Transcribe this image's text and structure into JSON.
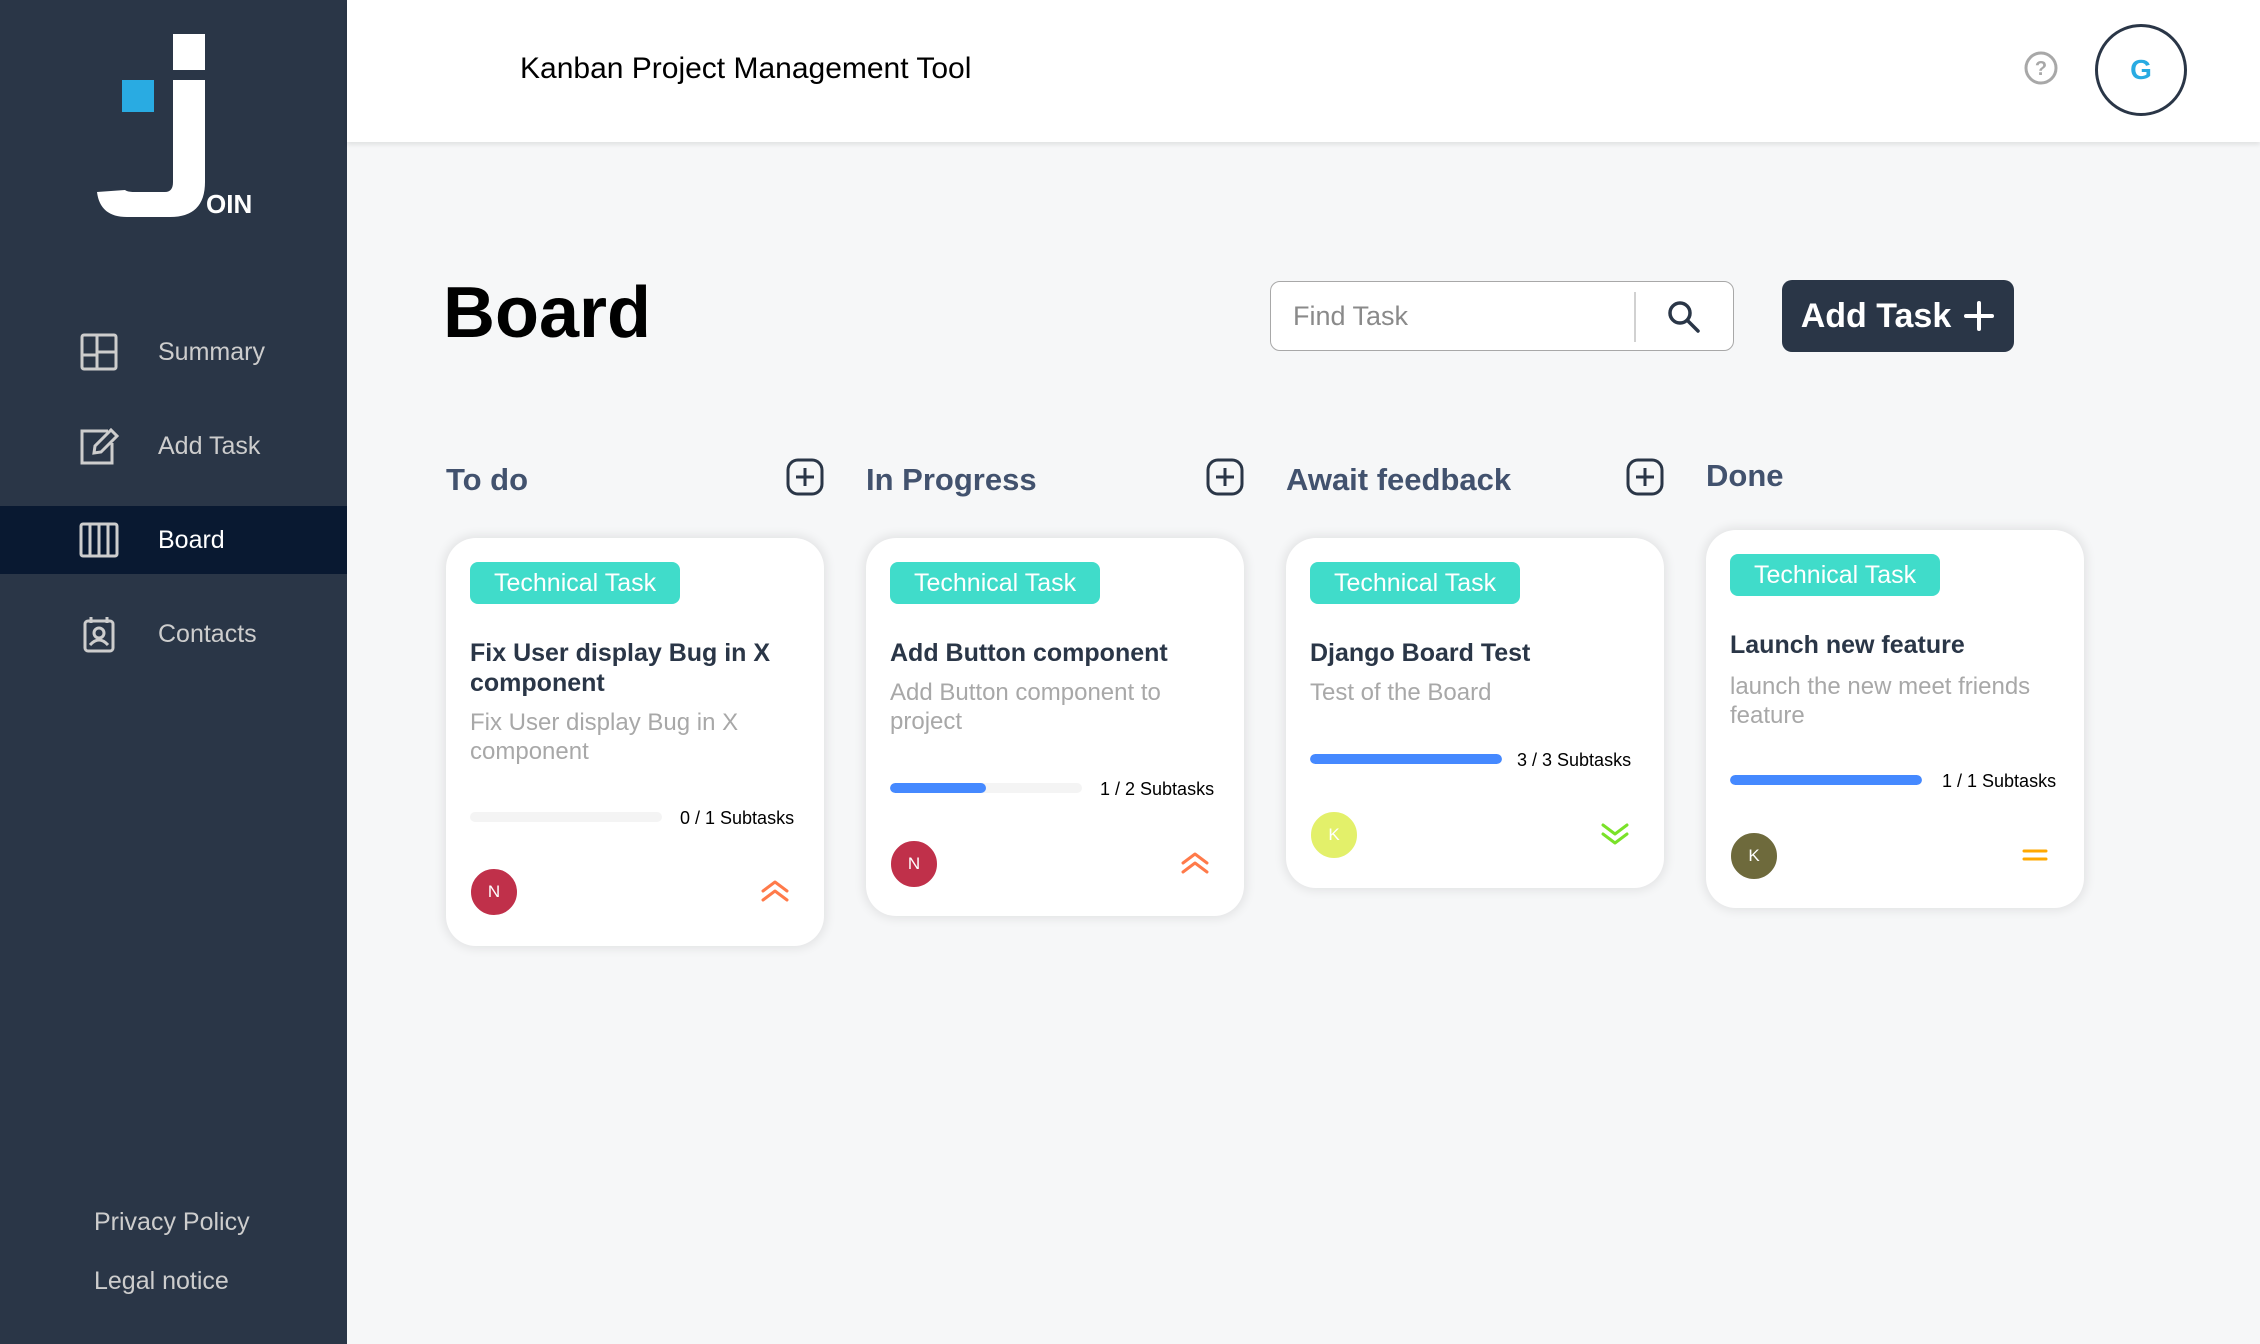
{
  "app": {
    "title": "Kanban Project Management Tool",
    "logo_text": "OIN",
    "user_initial": "G"
  },
  "sidebar": {
    "items": [
      {
        "label": "Summary",
        "icon": "summary-icon"
      },
      {
        "label": "Add Task",
        "icon": "edit-icon"
      },
      {
        "label": "Board",
        "icon": "board-icon",
        "active": true
      },
      {
        "label": "Contacts",
        "icon": "contacts-icon"
      }
    ],
    "legal": {
      "privacy": "Privacy Policy",
      "notice": "Legal notice"
    }
  },
  "board": {
    "title": "Board",
    "search_placeholder": "Find Task",
    "add_task_label": "Add Task"
  },
  "columns": [
    {
      "title": "To do",
      "cards": [
        {
          "category": "Technical Task",
          "title": "Fix User display Bug in X component",
          "description": "Fix User display Bug in X component",
          "subtasks_done": 0,
          "subtasks_total": 1,
          "subtasks_text": "0 / 1 Subtasks",
          "assignee_initial": "N",
          "assignee_color": "#c0304a",
          "priority": "urgent",
          "priority_color": "#ff7a4a"
        }
      ]
    },
    {
      "title": "In Progress",
      "cards": [
        {
          "category": "Technical Task",
          "title": "Add Button component",
          "description": "Add Button component to project",
          "subtasks_done": 1,
          "subtasks_total": 2,
          "subtasks_text": "1 / 2 Subtasks",
          "assignee_initial": "N",
          "assignee_color": "#c0304a",
          "priority": "urgent",
          "priority_color": "#ff7a4a"
        }
      ]
    },
    {
      "title": "Await feedback",
      "cards": [
        {
          "category": "Technical Task",
          "title": "Django Board Test",
          "description": "Test of the Board",
          "subtasks_done": 3,
          "subtasks_total": 3,
          "subtasks_text": "3 / 3 Subtasks",
          "assignee_initial": "K",
          "assignee_color": "#e3f06a",
          "priority": "low",
          "priority_color": "#7ae229"
        }
      ]
    },
    {
      "title": "Done",
      "cards": [
        {
          "category": "Technical Task",
          "title": "Launch new feature",
          "description": "launch the new meet friends feature",
          "subtasks_done": 1,
          "subtasks_total": 1,
          "subtasks_text": "1 / 1 Subtasks",
          "assignee_initial": "K",
          "assignee_color": "#6e6a3c",
          "priority": "medium",
          "priority_color": "#ffa800"
        }
      ]
    }
  ],
  "colors": {
    "sidebar_bg": "#2a3647",
    "sidebar_active": "#091931",
    "badge": "#1fd7c1",
    "progress": "#4589ff",
    "accent_blue": "#29abe2"
  }
}
